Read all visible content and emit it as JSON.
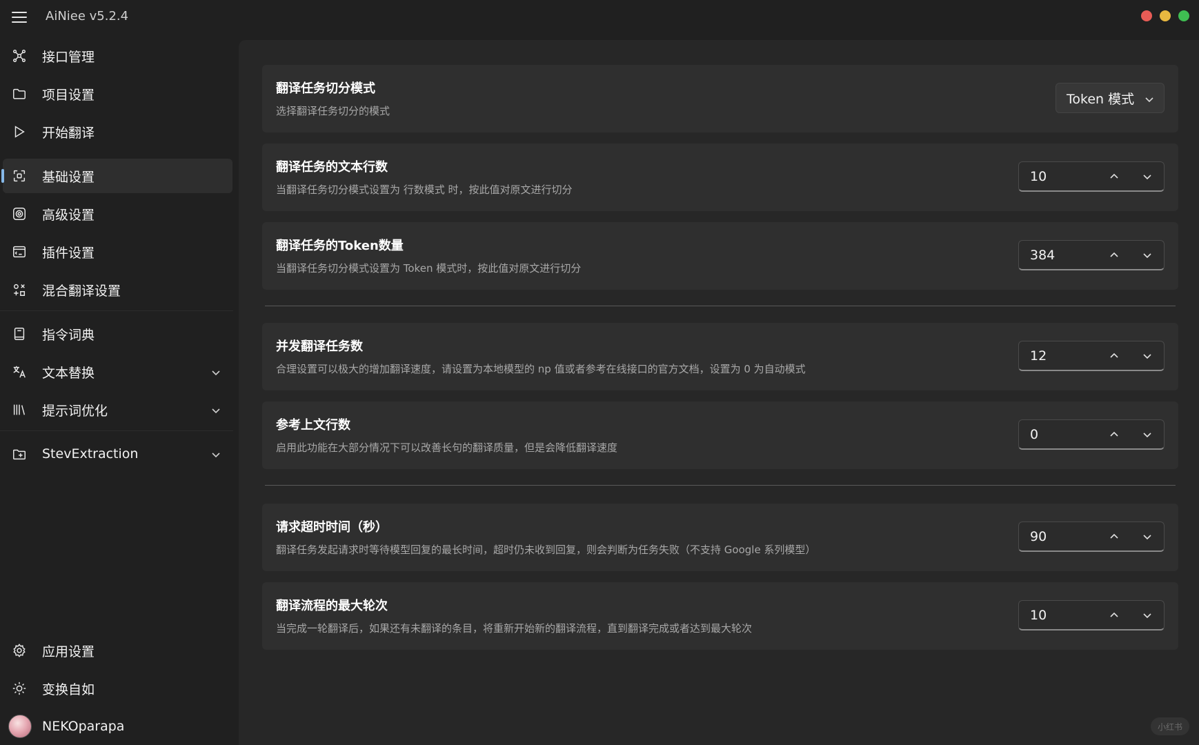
{
  "app": {
    "title": "AiNiee v5.2.4"
  },
  "sidebar": {
    "items": [
      {
        "label": "接口管理",
        "icon": "api-network-icon"
      },
      {
        "label": "项目设置",
        "icon": "folder-icon"
      },
      {
        "label": "开始翻译",
        "icon": "play-icon"
      },
      {
        "label": "基础设置",
        "icon": "basic-settings-icon",
        "active": true
      },
      {
        "label": "高级设置",
        "icon": "advanced-settings-icon"
      },
      {
        "label": "插件设置",
        "icon": "plugin-icon"
      },
      {
        "label": "混合翻译设置",
        "icon": "mixed-translate-icon"
      },
      {
        "label": "指令词典",
        "icon": "dictionary-icon"
      },
      {
        "label": "文本替换",
        "icon": "text-replace-icon",
        "expandable": true
      },
      {
        "label": "提示词优化",
        "icon": "prompt-optimize-icon",
        "expandable": true
      },
      {
        "label": "StevExtraction",
        "icon": "extraction-icon",
        "expandable": true
      }
    ],
    "bottom": [
      {
        "label": "应用设置",
        "icon": "gear-icon"
      },
      {
        "label": "变换自如",
        "icon": "theme-toggle-icon"
      },
      {
        "label": "NEKOparapa",
        "icon": "avatar"
      }
    ]
  },
  "settings": [
    {
      "title": "翻译任务切分模式",
      "desc": "选择翻译任务切分的模式",
      "control": "dropdown",
      "value": "Token 模式"
    },
    {
      "title": "翻译任务的文本行数",
      "desc": "当翻译任务切分模式设置为 行数模式 时，按此值对原文进行切分",
      "control": "spinbox",
      "value": "10"
    },
    {
      "title": "翻译任务的Token数量",
      "desc": "当翻译任务切分模式设置为 Token 模式时，按此值对原文进行切分",
      "control": "spinbox",
      "value": "384"
    },
    {
      "title": "并发翻译任务数",
      "desc": "合理设置可以极大的增加翻译速度，请设置为本地模型的 np 值或者参考在线接口的官方文档，设置为 0 为自动模式",
      "control": "spinbox",
      "value": "12"
    },
    {
      "title": "参考上文行数",
      "desc": "启用此功能在大部分情况下可以改善长句的翻译质量，但是会降低翻译速度",
      "control": "spinbox",
      "value": "0"
    },
    {
      "title": "请求超时时间（秒）",
      "desc": "翻译任务发起请求时等待模型回复的最长时间，超时仍未收到回复，则会判断为任务失败（不支持 Google 系列模型）",
      "control": "spinbox",
      "value": "90"
    },
    {
      "title": "翻译流程的最大轮次",
      "desc": "当完成一轮翻译后，如果还有未翻译的条目，将重新开始新的翻译流程，直到翻译完成或者达到最大轮次",
      "control": "spinbox",
      "value": "10"
    }
  ],
  "watermark": "小红书",
  "colors": {
    "accent": "#86b8e8",
    "close": "#e95c56",
    "minimize": "#e9b840",
    "maximize": "#3fbd52"
  }
}
